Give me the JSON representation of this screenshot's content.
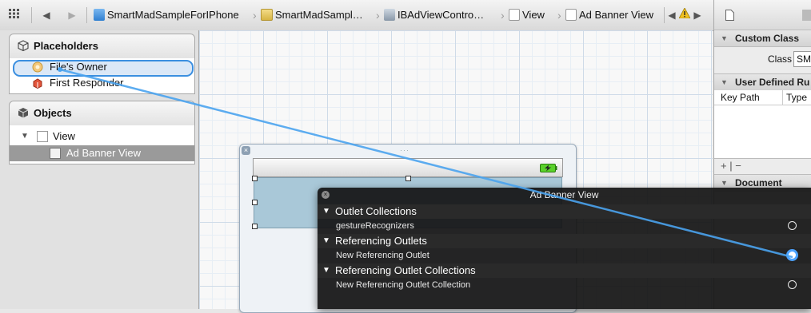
{
  "jumpbar": {
    "grid_icon": "grid-icon",
    "back_glyph": "◀",
    "forward_glyph": "▶",
    "crumbs": [
      {
        "label": "SmartMadSampleForIPhone",
        "icon": "xcode-project-icon"
      },
      {
        "label": "SmartMadSampl…",
        "icon": "folder-icon"
      },
      {
        "label": "IBAdViewContro…",
        "icon": "xib-file-icon"
      },
      {
        "label": "View",
        "icon": "view-icon"
      },
      {
        "label": "Ad Banner View",
        "icon": "view-icon"
      }
    ],
    "nav_left_glyph": "◀",
    "warning_icon": "warning-icon",
    "nav_right_glyph": "▶"
  },
  "outline": {
    "placeholders": {
      "title": "Placeholders",
      "items": [
        "File's Owner",
        "First Responder"
      ]
    },
    "objects": {
      "title": "Objects",
      "items": [
        "View",
        "Ad Banner View"
      ]
    }
  },
  "hud": {
    "title": "Ad Banner View",
    "sections": [
      {
        "label": "Outlet Collections",
        "items": [
          "gestureRecognizers"
        ]
      },
      {
        "label": "Referencing Outlets",
        "items": [
          "New Referencing Outlet"
        ]
      },
      {
        "label": "Referencing Outlet Collections",
        "items": [
          "New Referencing Outlet Collection"
        ]
      }
    ]
  },
  "inspector": {
    "custom_class": {
      "title": "Custom Class",
      "class_label": "Class",
      "class_value": "SM"
    },
    "user_defined": {
      "title": "User Defined Ru",
      "col_key": "Key Path",
      "col_type": "Type"
    },
    "add_remove": "+ | −",
    "document": {
      "title": "Document"
    }
  },
  "colors": {
    "selection": "#3b8fe0",
    "connection_line": "#4aa3ee",
    "hud_bg": "#141414"
  }
}
